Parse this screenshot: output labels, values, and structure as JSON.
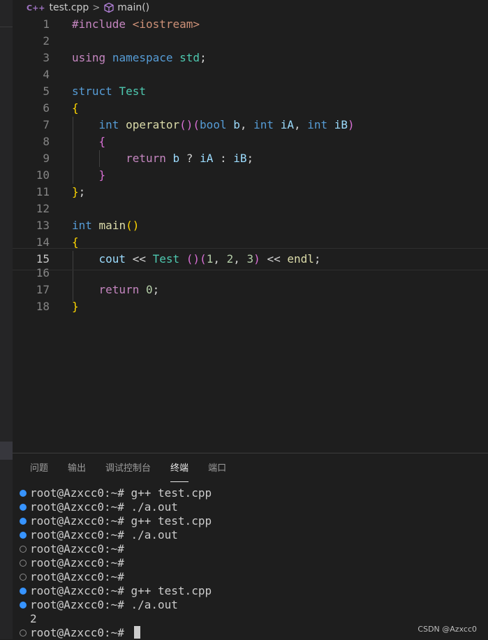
{
  "breadcrumb": {
    "file_icon": "C++",
    "file": "test.cpp",
    "separator": ">",
    "symbol_icon": "cube-icon",
    "symbol": "main()"
  },
  "editor": {
    "line_numbers": [
      "1",
      "2",
      "3",
      "4",
      "5",
      "6",
      "7",
      "8",
      "9",
      "10",
      "11",
      "12",
      "13",
      "14",
      "15",
      "16",
      "17",
      "18"
    ],
    "active_line": "15",
    "code": {
      "l1a": "#include",
      "l1b": "<iostream>",
      "l3a": "using",
      "l3b": "namespace",
      "l3c": "std",
      "l3d": ";",
      "l5a": "struct",
      "l5b": "Test",
      "l6a": "{",
      "l7a": "int",
      "l7b": "operator",
      "l7c": "()",
      "l7d": "(",
      "l7e": "bool",
      "l7f": "b",
      "l7g": ",",
      "l7h": "int",
      "l7i": "iA",
      "l7j": ",",
      "l7k": "int",
      "l7l": "iB",
      "l7m": ")",
      "l8a": "{",
      "l9a": "return",
      "l9b": "b",
      "l9c": "?",
      "l9d": "iA",
      "l9e": ":",
      "l9f": "iB",
      "l9g": ";",
      "l10a": "}",
      "l11a": "}",
      "l11b": ";",
      "l13a": "int",
      "l13b": "main",
      "l13c": "()",
      "l14a": "{",
      "l15a": "cout",
      "l15b": "<<",
      "l15c": "Test",
      "l15d": "()",
      "l15e": "(",
      "l15f": "1",
      "l15g": ",",
      "l15h": "2",
      "l15i": ",",
      "l15j": "3",
      "l15k": ")",
      "l15l": "<<",
      "l15m": "endl",
      "l15n": ";",
      "l17a": "return",
      "l17b": "0",
      "l17c": ";",
      "l18a": "}"
    }
  },
  "panel": {
    "tabs": [
      {
        "label": "问题"
      },
      {
        "label": "输出"
      },
      {
        "label": "调试控制台"
      },
      {
        "label": "终端",
        "active": true
      },
      {
        "label": "端口"
      }
    ]
  },
  "terminal": {
    "lines": [
      {
        "status": "success",
        "text": "root@Azxcc0:~# g++ test.cpp"
      },
      {
        "status": "success",
        "text": "root@Azxcc0:~# ./a.out"
      },
      {
        "status": "success",
        "text": "root@Azxcc0:~# g++ test.cpp"
      },
      {
        "status": "success",
        "text": "root@Azxcc0:~# ./a.out"
      },
      {
        "status": "none",
        "text": "root@Azxcc0:~#"
      },
      {
        "status": "none",
        "text": "root@Azxcc0:~#"
      },
      {
        "status": "none",
        "text": "root@Azxcc0:~#"
      },
      {
        "status": "success",
        "text": "root@Azxcc0:~# g++ test.cpp"
      },
      {
        "status": "success",
        "text": "root@Azxcc0:~# ./a.out"
      },
      {
        "status": "output",
        "text": "2"
      },
      {
        "status": "none",
        "text": "root@Azxcc0:~# "
      }
    ]
  },
  "watermark": "CSDN @Azxcc0",
  "colors": {
    "background": "#1e1e1e",
    "keyword": "#569cd6",
    "type": "#4ec9b0",
    "function": "#dcdcaa",
    "variable": "#9cdcfe",
    "string": "#ce9178",
    "number": "#b5cea8",
    "control": "#c586c0",
    "terminal_dot": "#3794ff"
  }
}
